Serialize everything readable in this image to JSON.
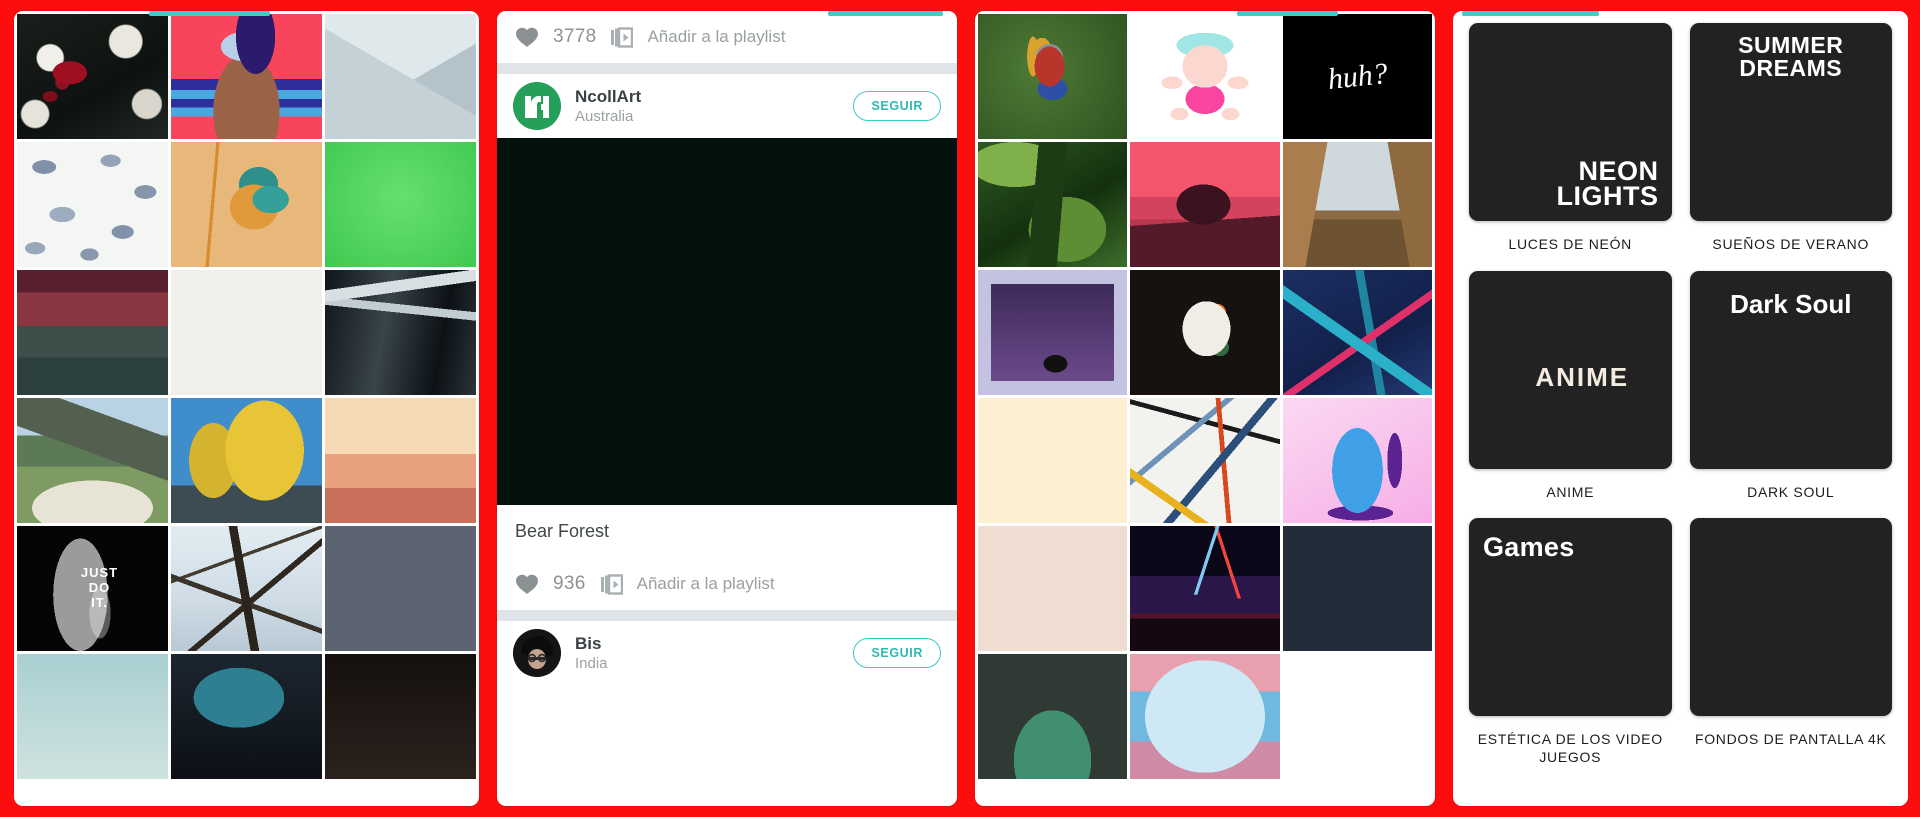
{
  "app": {
    "accent": "#3dc8c2",
    "background": "#fd0d0d",
    "screens": 4
  },
  "panel1": {
    "name": "wallpaper-grid-screen",
    "scroll_indicator": {
      "left_pct": 29,
      "width_pct": 26
    },
    "tiles": [
      {
        "id": "t1",
        "alt": "red-rose-dark-foliage"
      },
      {
        "id": "t2",
        "alt": "woman-vr-goggles-pink"
      },
      {
        "id": "t3",
        "alt": "minimal-grey-mountains"
      },
      {
        "id": "t4",
        "alt": "blue-tropical-leaves-pattern"
      },
      {
        "id": "t5",
        "alt": "kingfisher-bird-illustration"
      },
      {
        "id": "t6",
        "alt": "avocado-green"
      },
      {
        "id": "t7",
        "alt": "astronaut-red-sky-moon"
      },
      {
        "id": "t8",
        "alt": "blue-ink-woman-plants"
      },
      {
        "id": "t9",
        "alt": "icicles-black-white"
      },
      {
        "id": "t10",
        "alt": "mountain-meadow-beargrass"
      },
      {
        "id": "t11",
        "alt": "yellow-ginkgo-trees-sky"
      },
      {
        "id": "t12",
        "alt": "skateboard-dog-desert"
      },
      {
        "id": "t13",
        "alt": "just-do-it-black"
      },
      {
        "id": "t14",
        "alt": "bare-tree-winter-sky"
      },
      {
        "id": "t15",
        "alt": "succulents-pattern-grey"
      },
      {
        "id": "t16",
        "alt": "teal-partial"
      },
      {
        "id": "t17",
        "alt": "dark-partial"
      },
      {
        "id": "t18",
        "alt": "dark-partial-2"
      }
    ]
  },
  "panel2": {
    "name": "feed-screen",
    "scroll_indicator": {
      "left_pct": 72,
      "width_pct": 25
    },
    "top_post": {
      "likes": "3778",
      "playlist_label": "Añadir a la playlist",
      "like_icon": "heart-icon",
      "playlist_icon": "add-to-playlist-icon"
    },
    "author": {
      "name": "NcollArt",
      "location": "Australia",
      "avatar_alt": "ncollart-logo-green",
      "follow_label": "SEGUIR"
    },
    "photo": {
      "alt": "bear-forest-green-pine-silhouette"
    },
    "photo_title": "Bear Forest",
    "second_post": {
      "likes": "936",
      "playlist_label": "Añadir a la playlist"
    },
    "second_author": {
      "name": "Bis",
      "location": "India",
      "avatar_alt": "bis-portrait-bw",
      "follow_label": "SEGUIR"
    }
  },
  "panel3": {
    "name": "discover-grid-screen",
    "scroll_indicator": {
      "left_pct": 57,
      "width_pct": 22
    },
    "tiles": [
      {
        "id": "u1",
        "alt": "pixel-knight-green"
      },
      {
        "id": "u2",
        "alt": "cute-pink-lamb-toy"
      },
      {
        "id": "u3",
        "alt": "huh-handwriting-black"
      },
      {
        "id": "u4",
        "alt": "mossy-forest-log"
      },
      {
        "id": "u5",
        "alt": "pink-dunes-lone-tree"
      },
      {
        "id": "u6",
        "alt": "wooden-corridor-graffiti"
      },
      {
        "id": "u7",
        "alt": "halloween-pumpkin-black-cat"
      },
      {
        "id": "u8",
        "alt": "geisha-white-hair-dark"
      },
      {
        "id": "u9",
        "alt": "blue-low-poly-abstract"
      },
      {
        "id": "u10",
        "alt": "autumn-trees-flat-illustration"
      },
      {
        "id": "u11",
        "alt": "paint-chips-collage"
      },
      {
        "id": "u12",
        "alt": "blue-monster-pink-mouth"
      },
      {
        "id": "u13",
        "alt": "terracotta-circle-flower"
      },
      {
        "id": "u14",
        "alt": "lightsaber-duel-night"
      },
      {
        "id": "u15",
        "alt": "dark-floral-pattern"
      },
      {
        "id": "u16",
        "alt": "green-alien-dark"
      },
      {
        "id": "u17",
        "alt": "blue-pink-clouds"
      },
      {
        "id": "u18",
        "alt": "empty-white"
      }
    ]
  },
  "panel4": {
    "name": "collections-screen",
    "scroll_indicator": {
      "left_pct": 2,
      "width_pct": 30
    },
    "collections": [
      {
        "label": "LUCES DE NEÓN",
        "art": "neon-lights",
        "overlay": "NEON\nLIGHTS"
      },
      {
        "label": "SUEÑOS DE VERANO",
        "art": "summer-dreams",
        "overlay": "SUMMER\nDREAMS"
      },
      {
        "label": "ANIME",
        "art": "anime",
        "overlay": "ANIME"
      },
      {
        "label": "DARK SOUL",
        "art": "dark-soul",
        "overlay": "Dark Soul"
      },
      {
        "label": "ESTÉTICA DE LOS VIDEO JUEGOS",
        "art": "games",
        "overlay": "Games"
      },
      {
        "label": "FONDOS DE PANTALLA 4K",
        "art": "wallpapers4k",
        "overlay": ""
      }
    ],
    "overlay_text": {
      "neon_l1": "NEON",
      "neon_l2": "LIGHTS",
      "summer_l1": "SUMMER",
      "summer_l2": "DREAMS",
      "anime": "ANIME",
      "darksoul": "Dark Soul",
      "games": "Games"
    }
  }
}
